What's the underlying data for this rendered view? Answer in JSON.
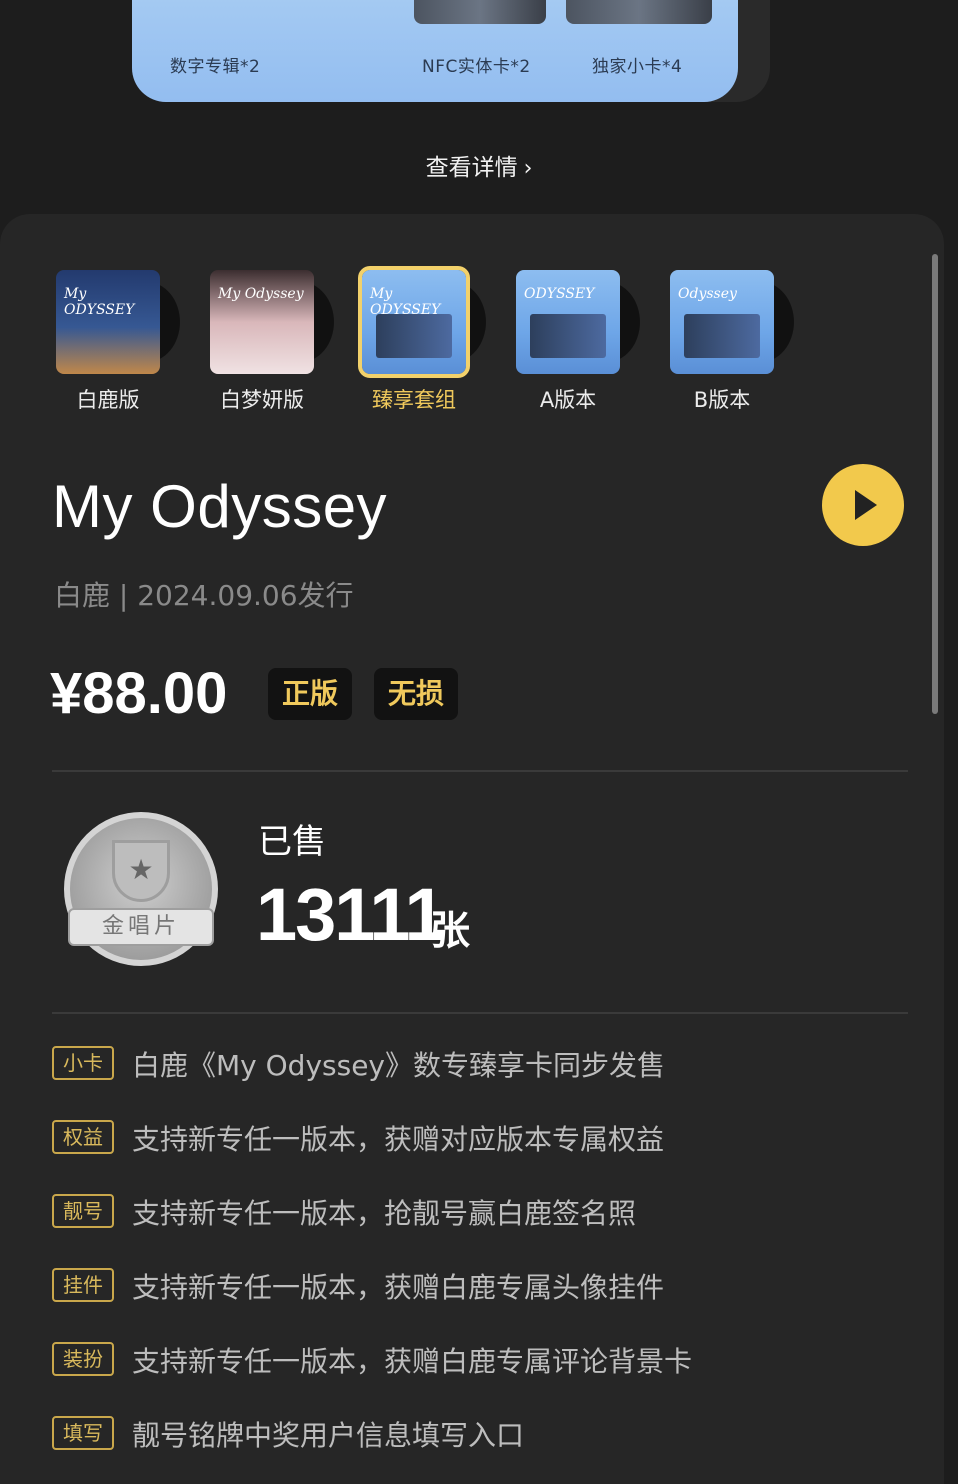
{
  "package": {
    "items": [
      "数字专辑*2",
      "NFC实体卡*2",
      "独家小卡*4"
    ]
  },
  "details_link": {
    "label": "查看详情",
    "icon": "chevron-right-icon"
  },
  "versions": [
    {
      "label": "白鹿版",
      "cover_text": "My ODYSSEY",
      "selected": false
    },
    {
      "label": "白梦妍版",
      "cover_text": "My Odyssey",
      "selected": false
    },
    {
      "label": "臻享套组",
      "cover_text": "My ODYSSEY",
      "selected": true
    },
    {
      "label": "A版本",
      "cover_text": "ODYSSEY",
      "selected": false
    },
    {
      "label": "B版本",
      "cover_text": "Odyssey",
      "selected": false
    }
  ],
  "album": {
    "title": "My Odyssey",
    "meta": "白鹿 | 2024.09.06发行",
    "price": "¥88.00",
    "badges": [
      "正版",
      "无损"
    ]
  },
  "sales": {
    "medal_text": "金唱片",
    "label": "已售",
    "count": "13111",
    "unit": "张"
  },
  "perks": [
    {
      "tag": "小卡",
      "text": "白鹿《My Odyssey》数专臻享卡同步发售"
    },
    {
      "tag": "权益",
      "text": "支持新专任一版本，获赠对应版本专属权益"
    },
    {
      "tag": "靓号",
      "text": "支持新专任一版本，抢靓号赢白鹿签名照"
    },
    {
      "tag": "挂件",
      "text": "支持新专任一版本，获赠白鹿专属头像挂件"
    },
    {
      "tag": "装扮",
      "text": "支持新专任一版本，获赠白鹿专属评论背景卡"
    },
    {
      "tag": "填写",
      "text": "靓号铭牌中奖用户信息填写入口"
    }
  ],
  "colors": {
    "accent": "#f2c94c",
    "background": "#1d1d1d",
    "panel": "#262626",
    "card": "#9cc5f2"
  }
}
